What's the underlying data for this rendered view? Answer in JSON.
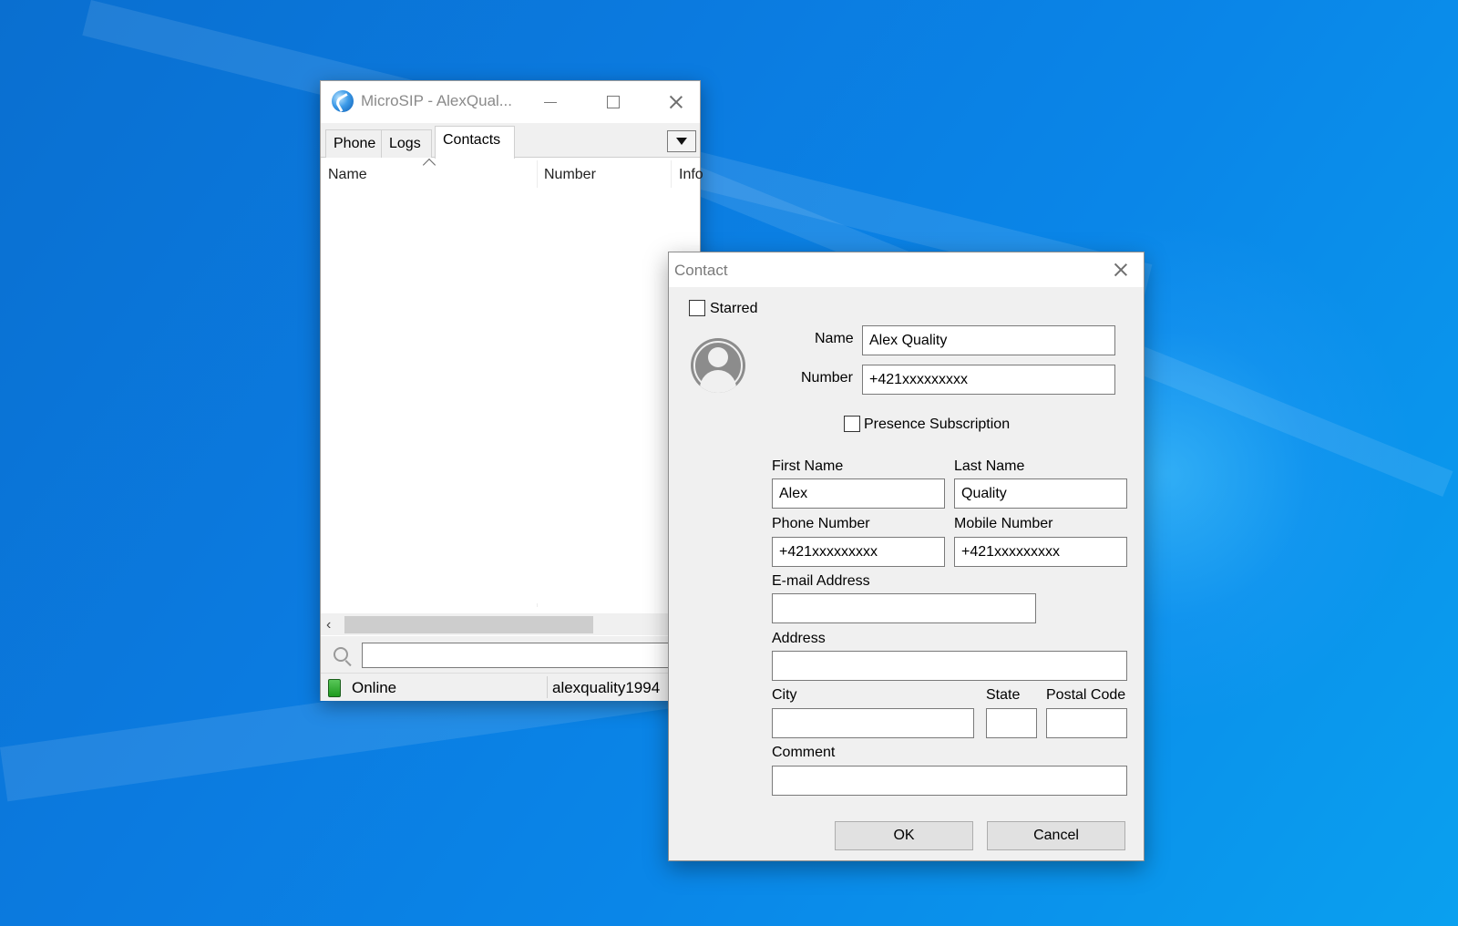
{
  "main_window": {
    "title": "MicroSIP - AlexQual...",
    "tabs": {
      "phone": "Phone",
      "logs": "Logs",
      "contacts": "Contacts"
    },
    "columns": {
      "name": "Name",
      "number": "Number",
      "info": "Info"
    },
    "search": {
      "value": "",
      "placeholder": ""
    },
    "status": {
      "text": "Online",
      "user": "alexquality1994",
      "color": "#2ea82e"
    }
  },
  "contact_dialog": {
    "title": "Contact",
    "starred_label": "Starred",
    "name_label": "Name",
    "name_value": "Alex Quality",
    "number_label": "Number",
    "number_value": "+421xxxxxxxxx",
    "presence_label": "Presence Subscription",
    "first_name_label": "First Name",
    "first_name_value": "Alex",
    "last_name_label": "Last Name",
    "last_name_value": "Quality",
    "phone_number_label": "Phone Number",
    "phone_number_value": "+421xxxxxxxxx",
    "mobile_number_label": "Mobile Number",
    "mobile_number_value": "+421xxxxxxxxx",
    "email_label": "E-mail Address",
    "email_value": "",
    "address_label": "Address",
    "address_value": "",
    "city_label": "City",
    "city_value": "",
    "state_label": "State",
    "state_value": "",
    "postal_code_label": "Postal Code",
    "postal_code_value": "",
    "comment_label": "Comment",
    "comment_value": "",
    "ok_label": "OK",
    "cancel_label": "Cancel"
  }
}
